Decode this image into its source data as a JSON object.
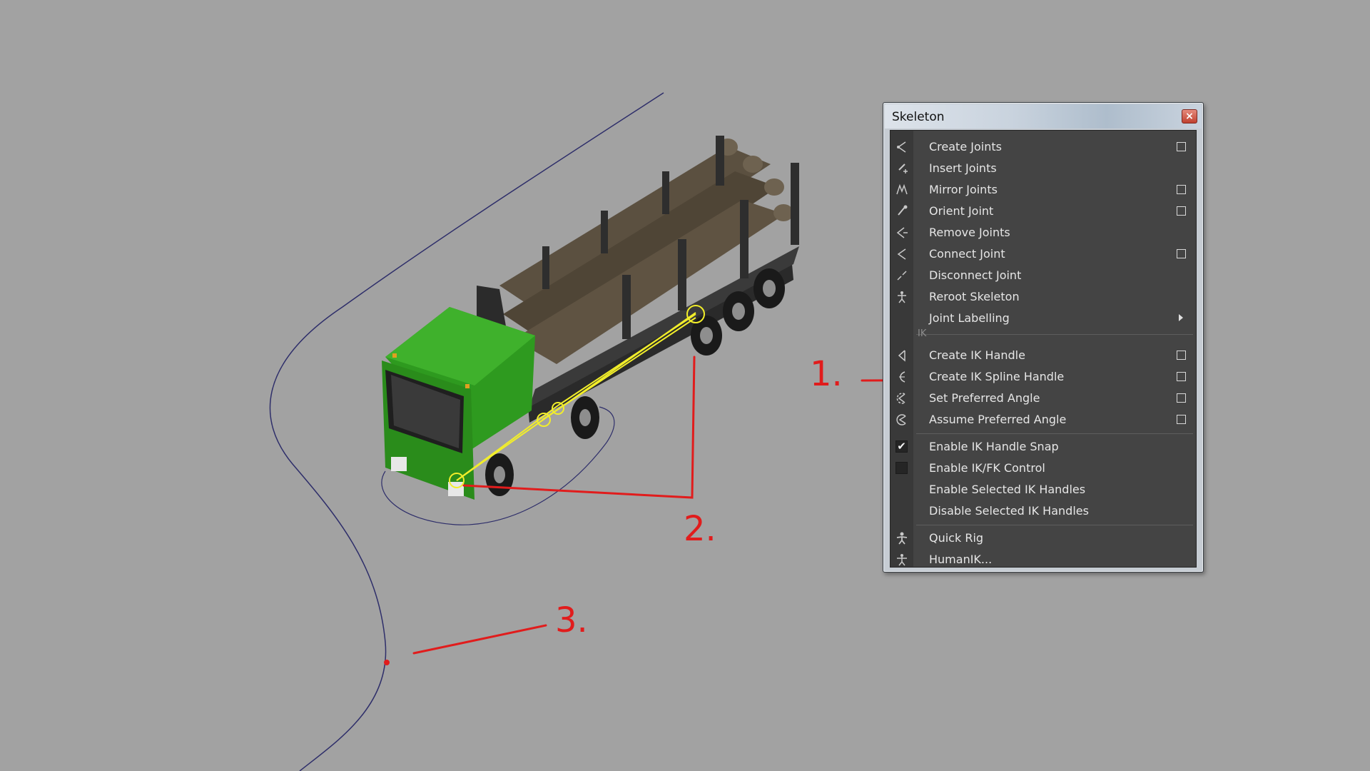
{
  "menu": {
    "title": "Skeleton",
    "close_glyph": "×",
    "items": [
      {
        "label": "Create Joints",
        "icon": "create-joints-icon",
        "option_box": true
      },
      {
        "label": "Insert Joints",
        "icon": "insert-joints-icon",
        "option_box": false
      },
      {
        "label": "Mirror Joints",
        "icon": "mirror-joints-icon",
        "option_box": true
      },
      {
        "label": "Orient Joint",
        "icon": "orient-joint-icon",
        "option_box": true
      },
      {
        "label": "Remove Joints",
        "icon": "remove-joints-icon",
        "option_box": false
      },
      {
        "label": "Connect Joint",
        "icon": "connect-joint-icon",
        "option_box": true
      },
      {
        "label": "Disconnect Joint",
        "icon": "disconnect-joint-icon",
        "option_box": false
      },
      {
        "label": "Reroot Skeleton",
        "icon": "reroot-skeleton-icon",
        "option_box": false
      },
      {
        "label": "Joint Labelling",
        "icon": "",
        "submenu": true
      }
    ],
    "ik_section_label": "IK",
    "ik_items": [
      {
        "label": "Create IK Handle",
        "icon": "ik-handle-icon",
        "option_box": true
      },
      {
        "label": "Create IK Spline Handle",
        "icon": "ik-spline-handle-icon",
        "option_box": true
      },
      {
        "label": "Set Preferred Angle",
        "icon": "set-preferred-angle-icon",
        "option_box": true
      },
      {
        "label": "Assume Preferred Angle",
        "icon": "assume-preferred-angle-icon",
        "option_box": true
      }
    ],
    "toggle_items": [
      {
        "label": "Enable IK Handle Snap",
        "checked": true
      },
      {
        "label": "Enable IK/FK Control",
        "checked": false
      },
      {
        "label": "Enable Selected IK Handles"
      },
      {
        "label": "Disable Selected IK Handles"
      }
    ],
    "rig_items": [
      {
        "label": "Quick Rig",
        "icon": "quick-rig-icon"
      },
      {
        "label": "HumanIK...",
        "icon": "humanik-icon"
      }
    ]
  },
  "annotations": [
    "1.",
    "2.",
    "3."
  ],
  "colors": {
    "viewport_bg": "#a2a2a2",
    "truck_cab": "#2e9a1f",
    "logs": "#5b5040",
    "ik_joints": "#f2ee2a",
    "annotation_red": "#e11c1c",
    "curve": "#2e2e6a"
  }
}
